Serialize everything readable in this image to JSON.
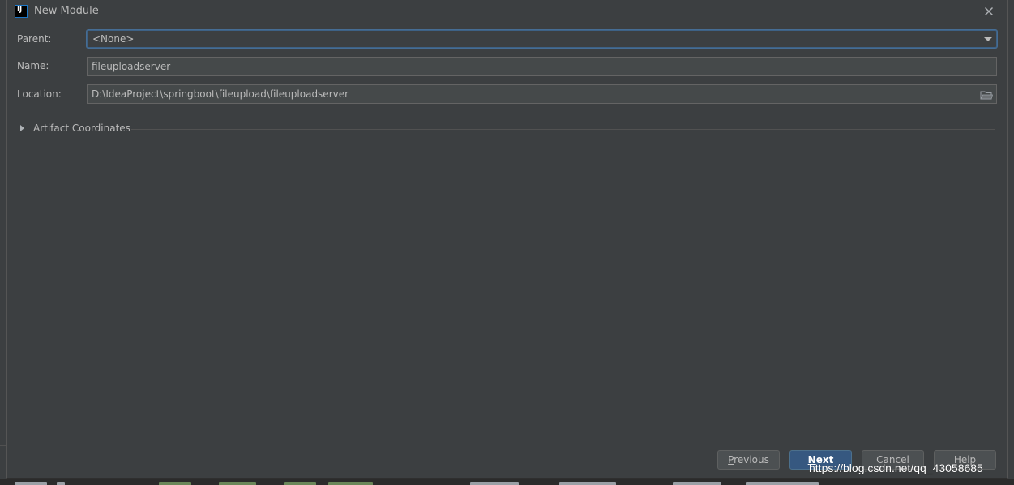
{
  "dialog": {
    "title": "New Module",
    "close_icon": "close-icon",
    "app_icon": "intellij-idea-icon"
  },
  "form": {
    "parent_label": "Parent:",
    "parent_value": "<None>",
    "name_label": "Name:",
    "name_value": "fileuploadserver",
    "location_label": "Location:",
    "location_value": "D:\\IdeaProject\\springboot\\fileupload\\fileuploadserver",
    "browse_icon": "folder-icon"
  },
  "artifact": {
    "label": "Artifact Coordinates",
    "expanded": false
  },
  "buttons": {
    "previous_mnemonic": "P",
    "previous_rest": "revious",
    "next_mnemonic": "N",
    "next_rest": "ext",
    "cancel_label": "Cancel",
    "help_label": "Help"
  },
  "watermark": "https://blog.csdn.net/qq_43058685",
  "colors": {
    "dialog_bg": "#3c3f41",
    "field_bg": "#45494a",
    "accent_blue": "#365880",
    "focus_border": "#466d94",
    "text": "#bbbbbb"
  }
}
